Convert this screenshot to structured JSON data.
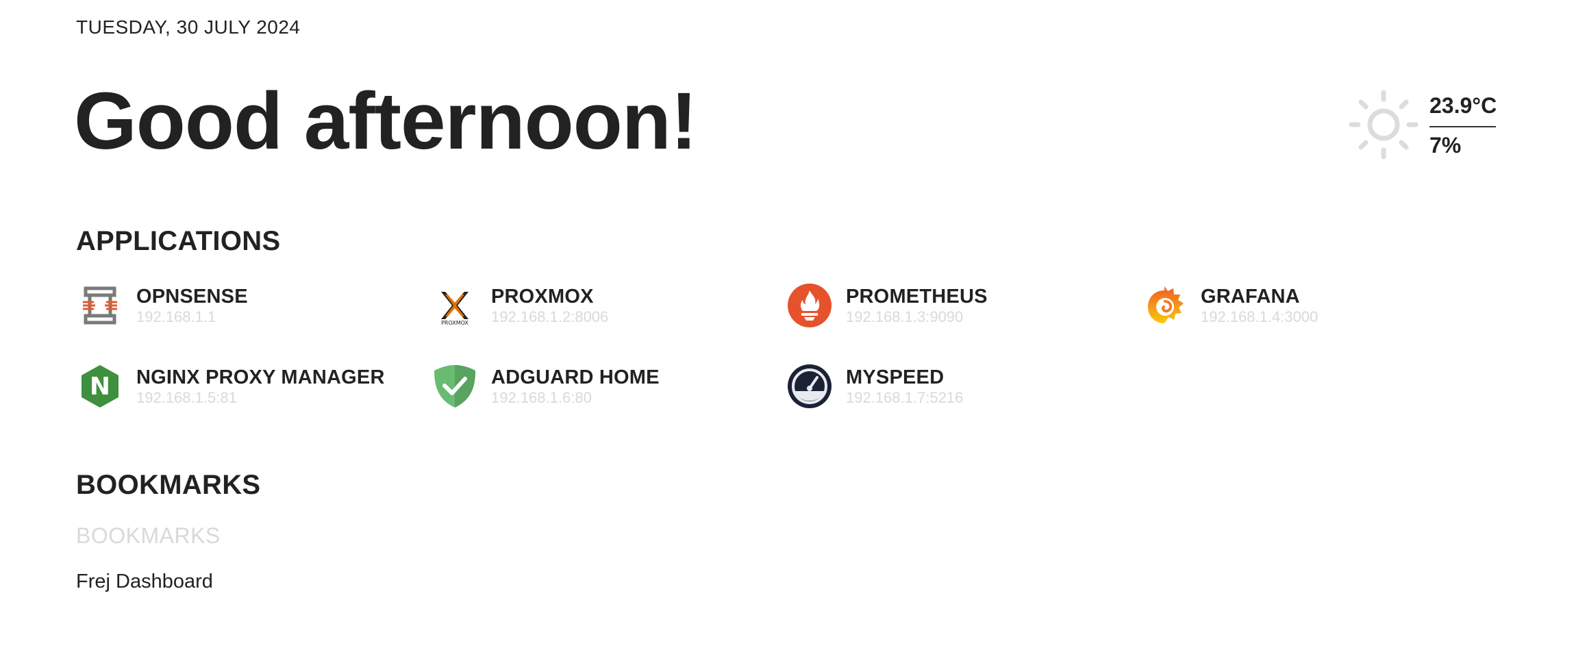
{
  "header": {
    "date": "TUESDAY, 30 JULY 2024",
    "greeting": "Good afternoon!"
  },
  "weather": {
    "icon": "sun-icon",
    "temperature": "23.9°C",
    "humidity": "7%"
  },
  "applications": {
    "title": "APPLICATIONS",
    "items": [
      {
        "name": "OPNSENSE",
        "address": "192.168.1.1",
        "icon": "opnsense-icon"
      },
      {
        "name": "PROXMOX",
        "address": "192.168.1.2:8006",
        "icon": "proxmox-icon",
        "icon_text": "PROXMOX"
      },
      {
        "name": "PROMETHEUS",
        "address": "192.168.1.3:9090",
        "icon": "prometheus-icon"
      },
      {
        "name": "GRAFANA",
        "address": "192.168.1.4:3000",
        "icon": "grafana-icon"
      },
      {
        "name": "NGINX PROXY MANAGER",
        "address": "192.168.1.5:81",
        "icon": "nginx-icon",
        "icon_text": "N"
      },
      {
        "name": "ADGUARD HOME",
        "address": "192.168.1.6:80",
        "icon": "adguard-icon"
      },
      {
        "name": "MYSPEED",
        "address": "192.168.1.7:5216",
        "icon": "myspeed-icon"
      }
    ]
  },
  "bookmarks": {
    "title": "BOOKMARKS",
    "group_label": "BOOKMARKS",
    "links": [
      {
        "label": "Frej Dashboard"
      }
    ]
  },
  "colors": {
    "text": "#222222",
    "muted": "#d9d9d9",
    "opnsense_orange": "#e8582a",
    "proxmox_orange": "#e57000",
    "prometheus": "#e6522c",
    "grafana_orange": "#f05a28",
    "grafana_yellow": "#fbca0a",
    "nginx_green": "#3e8f3e",
    "adguard_green": "#68bc71",
    "myspeed_navy": "#1b2235"
  }
}
